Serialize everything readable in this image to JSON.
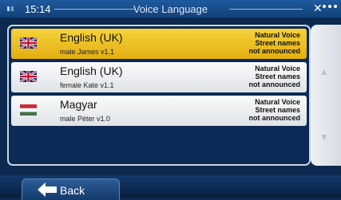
{
  "status_bar": {
    "time": "15:14",
    "title": "Voice Language"
  },
  "languages": [
    {
      "name": "English (UK)",
      "voice": "male James v1.1",
      "flag": "uk-flag-icon",
      "selected": true,
      "info": [
        "Natural Voice",
        "Street names",
        "not announced"
      ]
    },
    {
      "name": "English (UK)",
      "voice": "female Kate v1.1",
      "flag": "uk-flag-icon",
      "selected": false,
      "info": [
        "Natural Voice",
        "Street names",
        "not announced"
      ]
    },
    {
      "name": "Magyar",
      "voice": "male Péter v1.0",
      "flag": "hungary-flag-icon",
      "selected": false,
      "info": [
        "Natural Voice",
        "Street names",
        "not announced"
      ]
    }
  ],
  "bottom_bar": {
    "back_label": "Back"
  },
  "colors": {
    "selected_row": "#f2c72a",
    "background": "#0c2a4f"
  }
}
